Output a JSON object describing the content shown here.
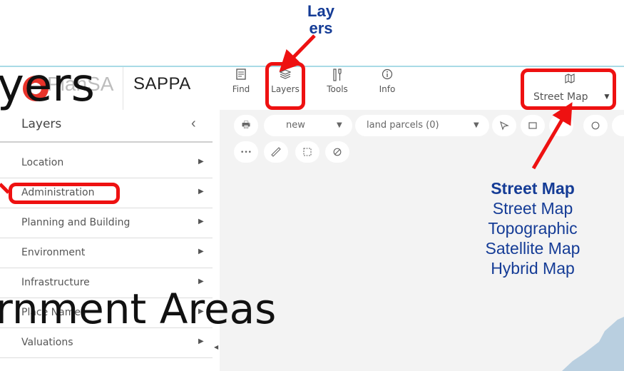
{
  "app": {
    "logo_text": "PlanSA",
    "product_name": "SAPPA"
  },
  "toolbar": {
    "buttons": [
      {
        "label": "Find",
        "icon": "find-icon"
      },
      {
        "label": "Layers",
        "icon": "layers-icon"
      },
      {
        "label": "Tools",
        "icon": "tools-icon"
      },
      {
        "label": "Info",
        "icon": "info-icon"
      }
    ],
    "basemap": {
      "label": "Street Map",
      "icon": "map-icon"
    }
  },
  "sidebar": {
    "title": "Layers",
    "items": [
      {
        "label": "Location"
      },
      {
        "label": "Administration"
      },
      {
        "label": "Planning and Building"
      },
      {
        "label": "Environment"
      },
      {
        "label": "Infrastructure"
      },
      {
        "label": "Place Names"
      },
      {
        "label": "Valuations"
      }
    ]
  },
  "map_toolbar": {
    "new_select": "new",
    "parcel_select": "land parcels (0)"
  },
  "annotations": {
    "layers_callout_line1": "Lay",
    "layers_callout_line2": "ers",
    "overlay_heading": "yers",
    "overlay_subheading": "rnment Areas",
    "basemap_heading": "Street Map",
    "basemap_options": [
      "Street Map",
      "Topographic",
      "Satellite Map",
      "Hybrid Map"
    ],
    "colors": {
      "highlight": "#ee1111",
      "callout_text": "#153c96"
    }
  }
}
